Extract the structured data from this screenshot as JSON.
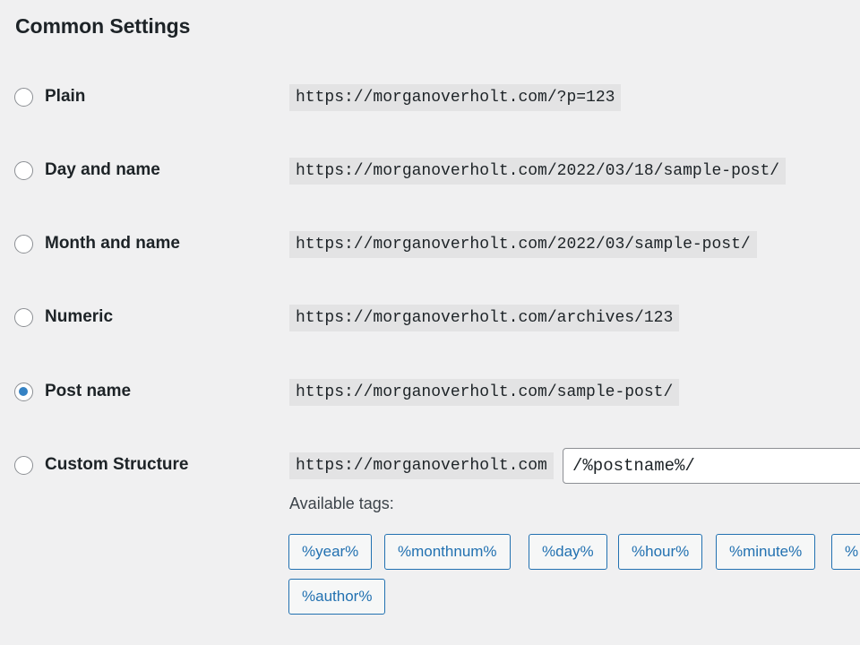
{
  "section": {
    "title": "Common Settings"
  },
  "options": [
    {
      "label": "Plain",
      "example": "https://morganoverholt.com/?p=123",
      "selected": false
    },
    {
      "label": "Day and name",
      "example": "https://morganoverholt.com/2022/03/18/sample-post/",
      "selected": false
    },
    {
      "label": "Month and name",
      "example": "https://morganoverholt.com/2022/03/sample-post/",
      "selected": false
    },
    {
      "label": "Numeric",
      "example": "https://morganoverholt.com/archives/123",
      "selected": false
    },
    {
      "label": "Post name",
      "example": "https://morganoverholt.com/sample-post/",
      "selected": true
    }
  ],
  "custom": {
    "label": "Custom Structure",
    "base_url": "https://morganoverholt.com",
    "value": "/%postname%/",
    "selected": false
  },
  "available_tags": {
    "heading": "Available tags:",
    "tags": [
      "%year%",
      "%monthnum%",
      "%day%",
      "%hour%",
      "%minute%",
      "%",
      "%author%"
    ]
  },
  "colors": {
    "accent": "#2271b1",
    "radio_checked": "#3582c4",
    "background": "#f0f0f1",
    "code_background": "#e3e3e4"
  },
  "icons": {
    "radio_unchecked": "radio-empty-icon",
    "radio_checked": "radio-filled-icon"
  }
}
